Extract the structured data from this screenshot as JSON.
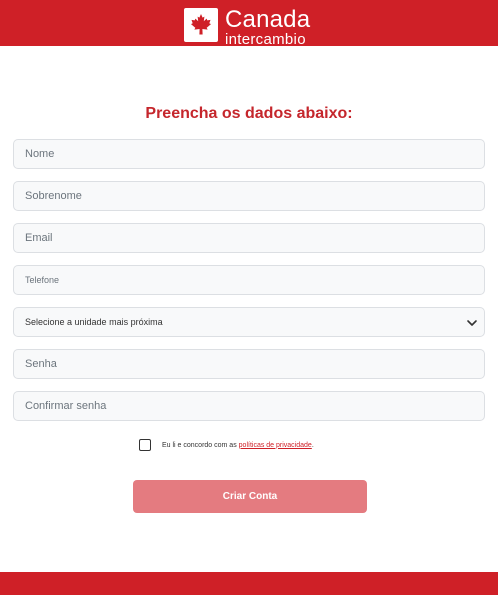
{
  "header": {
    "logo_name": "Canada",
    "logo_sub": "intercambio"
  },
  "form": {
    "title": "Preencha os dados abaixo:",
    "first_name_placeholder": "Nome",
    "last_name_placeholder": "Sobrenome",
    "email_placeholder": "Email",
    "phone_placeholder": "Telefone",
    "unit_select_value": "Selecione a unidade mais próxima",
    "password_placeholder": "Senha",
    "confirm_password_placeholder": "Confirmar senha",
    "terms_text": "Eu li e concordo com as",
    "terms_link": "políticas de privacidade",
    "terms_end": ".",
    "submit_label": "Criar Conta"
  },
  "colors": {
    "brand_red": "#cf2027",
    "title_red": "#c5262c",
    "button_disabled": "#e47b80"
  },
  "icons": {
    "logo": "maple-leaf-icon",
    "select": "chevron-down-icon"
  }
}
